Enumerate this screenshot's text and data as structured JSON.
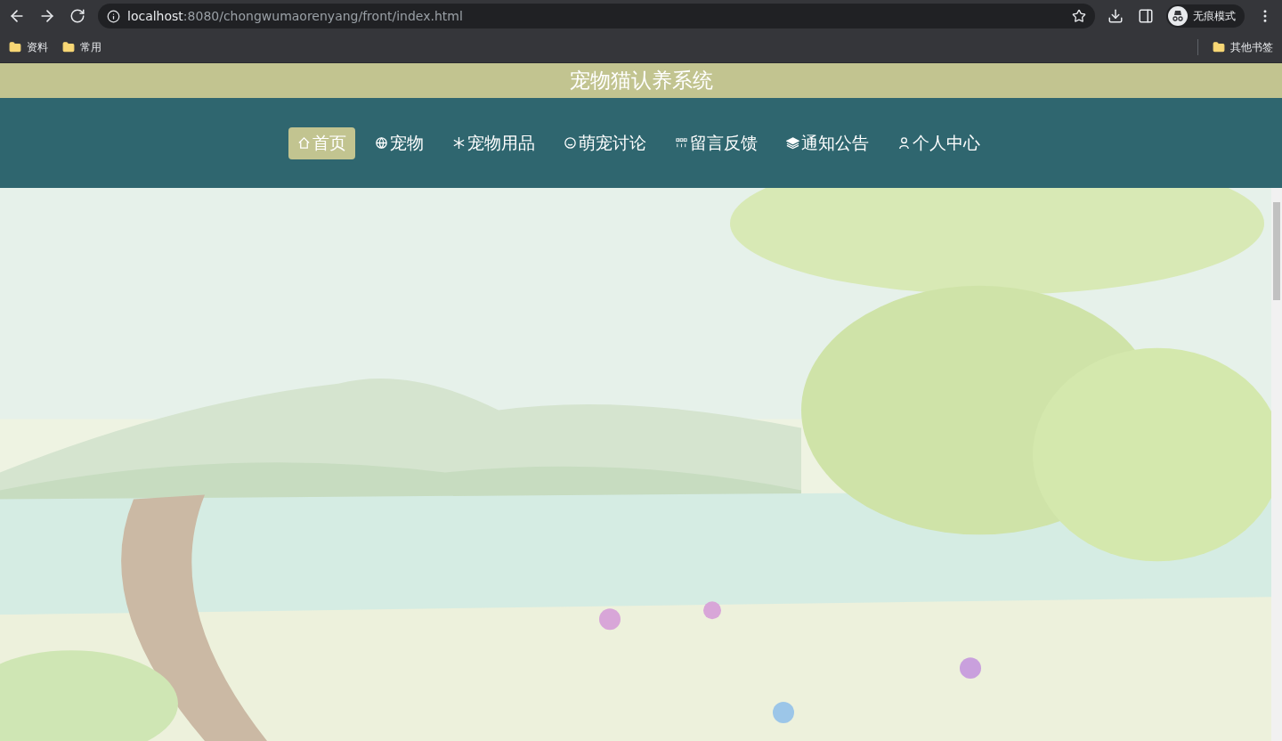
{
  "browser": {
    "address": "**localhost**:8080/chongwumaorenyang/front/index.html",
    "profile": "无痕模式",
    "bookmarks": [
      {
        "label": "资料"
      },
      {
        "label": "常用"
      }
    ],
    "other_bookmarks": "其他书签"
  },
  "site": {
    "title": "宠物猫认养系统"
  },
  "nav": [
    {
      "label": "首页",
      "kind": "home",
      "selected": true
    },
    {
      "label": "宠物",
      "kind": "pets",
      "selected": false
    },
    {
      "label": "宠物用品",
      "kind": "supplies",
      "selected": false
    },
    {
      "label": "萌宠讨论",
      "kind": "forum",
      "selected": false
    },
    {
      "label": "留言反馈",
      "kind": "feedback",
      "selected": false
    },
    {
      "label": "通知公告",
      "kind": "notices",
      "selected": false
    },
    {
      "label": "个人中心",
      "kind": "account",
      "selected": false
    }
  ]
}
